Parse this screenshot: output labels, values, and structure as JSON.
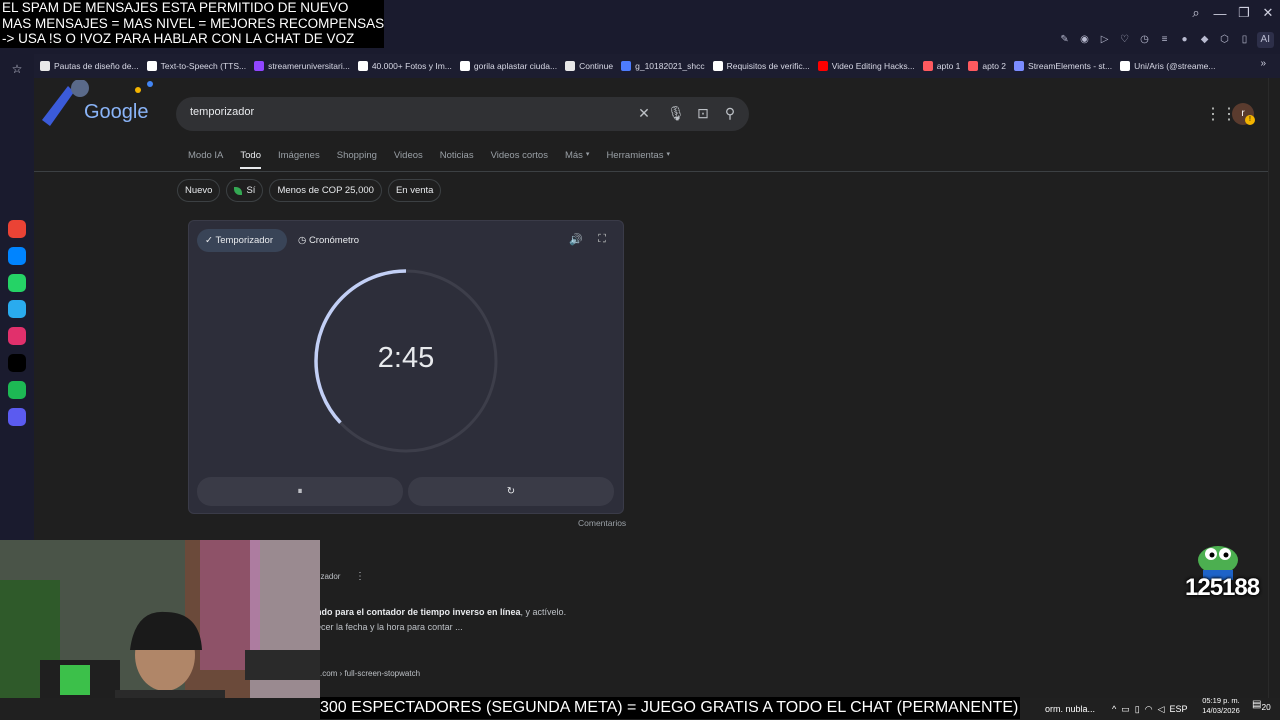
{
  "stream_overlay": {
    "lines": [
      "EL SPAM DE MENSAJES ESTA PERMITIDO DE NUEVO",
      "MAS MENSAJES = MAS NIVEL = MEJORES RECOMPENSAS",
      "-> USA !S O !VOZ PARA HABLAR CON LA CHAT DE VOZ"
    ],
    "banner": "300 ESPECTADORES (SEGUNDA META) = JUEGO GRATIS A TODO EL CHAT (PERMANENTE)",
    "counter": "125188"
  },
  "browser": {
    "window_controls": [
      "search-icon",
      "minimize-icon",
      "restore-icon",
      "close-icon"
    ],
    "ai_label": "AI",
    "bookmarks": [
      {
        "label": "Pautas de diseño de...",
        "icon": "doc-icon",
        "color": "#e8e8e8"
      },
      {
        "label": "Text-to-Speech (TTS...",
        "icon": "tts-icon",
        "color": "#ffffff"
      },
      {
        "label": "streameruniversitari...",
        "icon": "twitch-icon",
        "color": "#9146ff"
      },
      {
        "label": "40.000+ Fotos y Im...",
        "icon": "pixabay-icon",
        "color": "#ffffff"
      },
      {
        "label": "gorila aplastar ciuda...",
        "icon": "google-icon",
        "color": "#ffffff"
      },
      {
        "label": "Continue",
        "icon": "doc-icon",
        "color": "#e8e8e8"
      },
      {
        "label": "g_10182021_shcc",
        "icon": "blue-icon",
        "color": "#4d7cfe"
      },
      {
        "label": "Requisitos de verific...",
        "icon": "x-icon",
        "color": "#ffffff"
      },
      {
        "label": "Video Editing Hacks...",
        "icon": "youtube-icon",
        "color": "#ff0000"
      },
      {
        "label": "apto 1",
        "icon": "airbnb-icon",
        "color": "#ff5a5f"
      },
      {
        "label": "apto 2",
        "icon": "airbnb-icon",
        "color": "#ff5a5f"
      },
      {
        "label": "StreamElements - st...",
        "icon": "streamelements-icon",
        "color": "#7b8cff"
      },
      {
        "label": "Uni/Aris (@streame...",
        "icon": "tiktok-icon",
        "color": "#ffffff"
      }
    ],
    "sidebar_apps": [
      {
        "name": "gmail-icon",
        "color": "#ea4335"
      },
      {
        "name": "messenger-icon",
        "color": "#0084ff"
      },
      {
        "name": "whatsapp-icon",
        "color": "#25d366"
      },
      {
        "name": "telegram-icon",
        "color": "#2aabee"
      },
      {
        "name": "instagram-icon",
        "color": "#e1306c"
      },
      {
        "name": "x-icon",
        "color": "#000000"
      },
      {
        "name": "spotify-icon",
        "color": "#1db954"
      },
      {
        "name": "player-icon",
        "color": "#5b5bf0"
      }
    ]
  },
  "google": {
    "logo": "Google",
    "search_query": "temporizador",
    "avatar_letter": "r",
    "tabs": [
      "Modo IA",
      "Todo",
      "Imágenes",
      "Shopping",
      "Videos",
      "Noticias",
      "Videos cortos",
      "Más",
      "Herramientas"
    ],
    "active_tab": "Todo",
    "chips": [
      "Nuevo",
      "Sí",
      "Menos de COP 25,000",
      "En venta"
    ],
    "timer": {
      "tab_timer": "Temporizador",
      "tab_stopwatch": "Cronómetro",
      "time": "2:45",
      "remaining_fraction": 0.37,
      "pause_label": "⏸",
      "reset_label": "↻"
    },
    "feedback": "Comentarios",
    "results": {
      "source_suffix": "rizador",
      "snippet_bold": "ndo para el contador de tiempo inverso en línea",
      "snippet_rest": ", y actívelo.",
      "snippet_line2": "ecer la fecha y la hora para contar ...",
      "url2": ".com › full-screen-stopwatch"
    }
  },
  "taskbar": {
    "weather": "orm. nubla...",
    "lang": "ESP",
    "time": "05:19 p. m.",
    "date": "14/03/2026",
    "notifications": "20"
  }
}
